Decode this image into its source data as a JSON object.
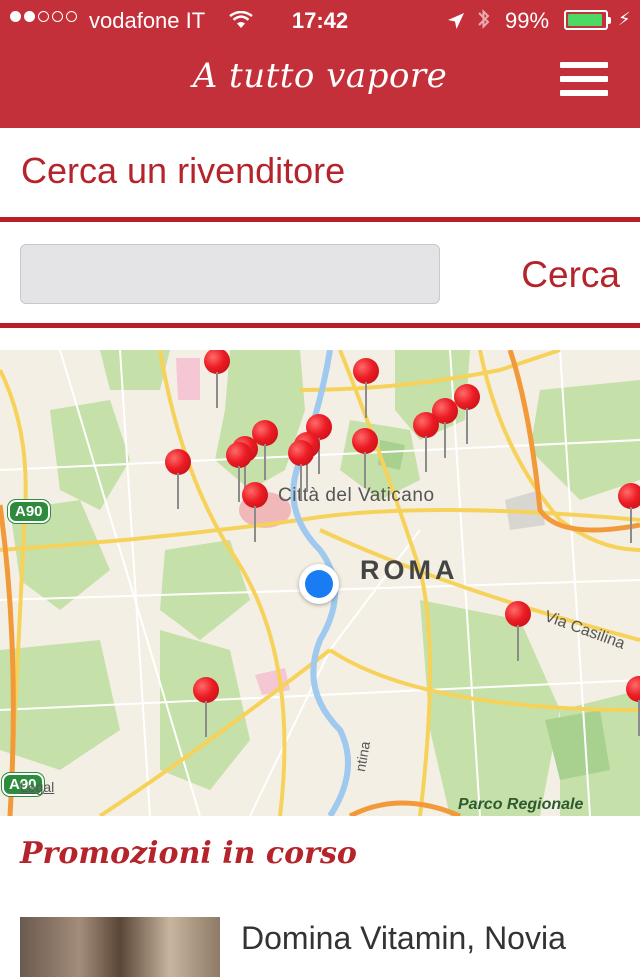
{
  "status_bar": {
    "carrier": "vodafone IT",
    "time": "17:42",
    "battery_percent": "99%"
  },
  "nav": {
    "title": "A tutto vapore",
    "menu_icon": "hamburger-menu-icon"
  },
  "search": {
    "title": "Cerca un rivenditore",
    "input_value": "",
    "input_placeholder": "",
    "button_label": "Cerca"
  },
  "map": {
    "labels": {
      "vaticano": "Città del Vaticano",
      "roma": "ROMA",
      "casilina": "Via Casilina",
      "parco": "Parco Regionale",
      "legal": "Legal",
      "tina": "ntina"
    },
    "road_shields": [
      "A90",
      "A90"
    ],
    "pin_count": 17
  },
  "promotions": {
    "title": "Promozioni in corso",
    "items": [
      {
        "title": "Domina Vitamin, Novia"
      }
    ]
  },
  "colors": {
    "brand_red": "#c4303a",
    "accent_red": "#b5232b",
    "pin_red": "#ec1c24",
    "user_location_blue": "#1a7cf3"
  }
}
